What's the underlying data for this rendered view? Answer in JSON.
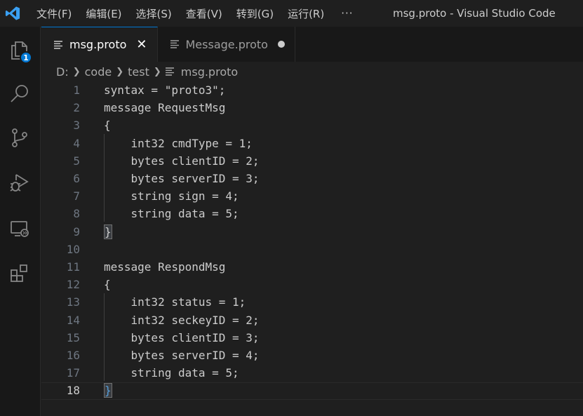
{
  "window": {
    "title": "msg.proto - Visual Studio Code"
  },
  "menu": {
    "items": [
      "文件(F)",
      "编辑(E)",
      "选择(S)",
      "查看(V)",
      "转到(G)",
      "运行(R)"
    ],
    "more": "···"
  },
  "activity": {
    "explorer_badge": "1",
    "icons": [
      "explorer-icon",
      "search-icon",
      "source-control-icon",
      "run-debug-icon",
      "remote-explorer-icon",
      "extensions-icon"
    ]
  },
  "tabs": [
    {
      "label": "msg.proto",
      "active": true,
      "close": "✕"
    },
    {
      "label": "Message.proto",
      "active": false,
      "dirty": true
    }
  ],
  "breadcrumb": {
    "drive": "D:",
    "folder1": "code",
    "folder2": "test",
    "file": "msg.proto"
  },
  "editor": {
    "lines": [
      {
        "n": "1",
        "text": "syntax = \"proto3\";"
      },
      {
        "n": "2",
        "text": "message RequestMsg"
      },
      {
        "n": "3",
        "text": "{"
      },
      {
        "n": "4",
        "text": "    int32 cmdType = 1;"
      },
      {
        "n": "5",
        "text": "    bytes clientID = 2;"
      },
      {
        "n": "6",
        "text": "    bytes serverID = 3;"
      },
      {
        "n": "7",
        "text": "    string sign = 4;"
      },
      {
        "n": "8",
        "text": "    string data = 5;"
      },
      {
        "n": "9",
        "text": "}"
      },
      {
        "n": "10",
        "text": ""
      },
      {
        "n": "11",
        "text": "message RespondMsg"
      },
      {
        "n": "12",
        "text": "{"
      },
      {
        "n": "13",
        "text": "    int32 status = 1;"
      },
      {
        "n": "14",
        "text": "    int32 seckeyID = 2;"
      },
      {
        "n": "15",
        "text": "    bytes clientID = 3;"
      },
      {
        "n": "16",
        "text": "    bytes serverID = 4;"
      },
      {
        "n": "17",
        "text": "    string data = 5;"
      },
      {
        "n": "18",
        "text": "}"
      }
    ],
    "current_line": "18"
  },
  "colors": {
    "accent": "#0078d4",
    "background": "#1f1f1f",
    "text": "#cccccc"
  }
}
